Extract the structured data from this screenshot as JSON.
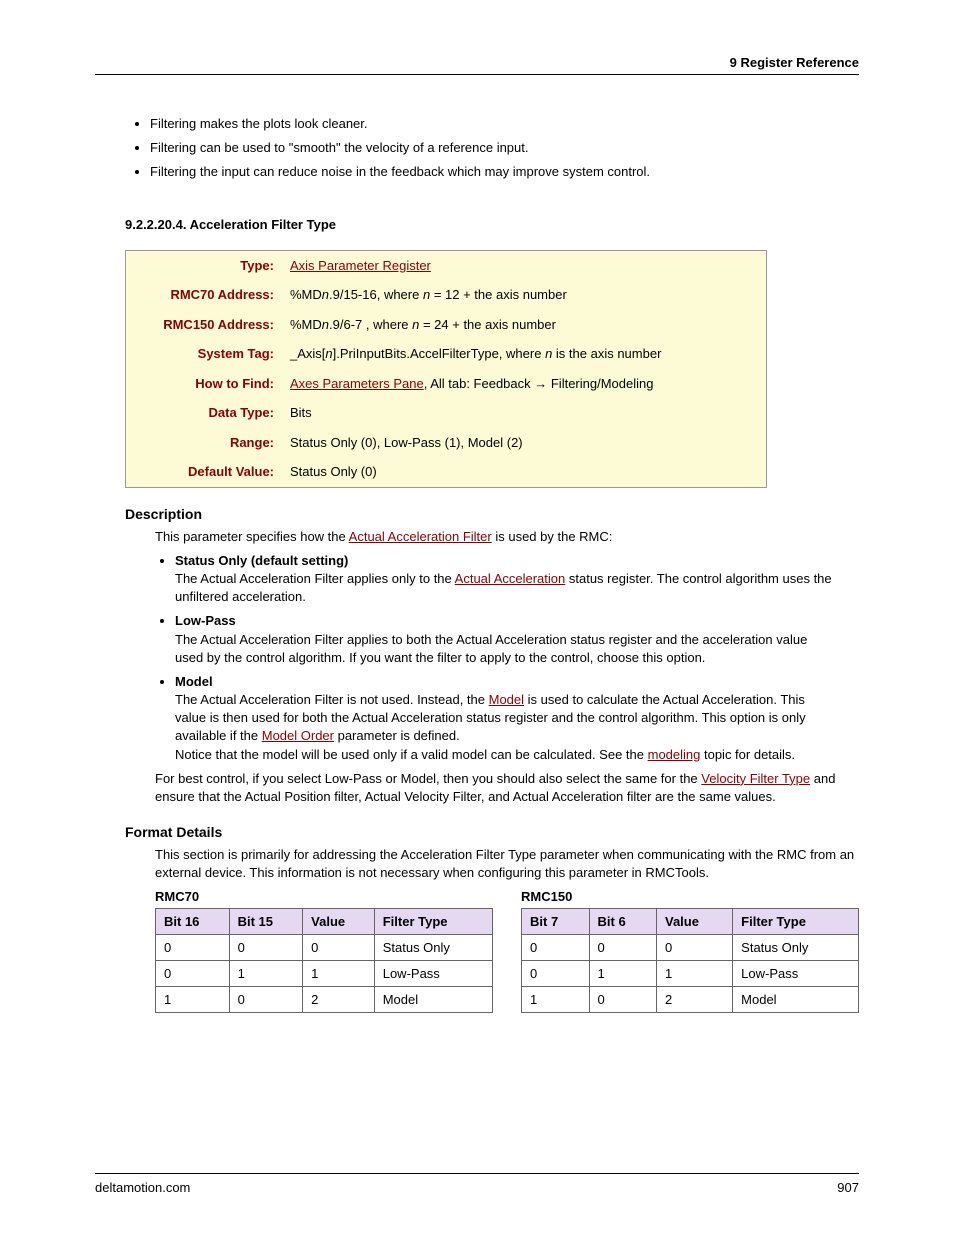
{
  "header": "9  Register Reference",
  "intro_bullets": [
    "Filtering makes the plots look cleaner.",
    "Filtering can be used to \"smooth\" the velocity of a reference input.",
    "Filtering the input can reduce noise in the feedback which may improve system control."
  ],
  "section_number": "9.2.2.20.4. Acceleration Filter Type",
  "params": {
    "type_label": "Type:",
    "type_value": "Axis Parameter Register",
    "rmc70_label": "RMC70 Address:",
    "rmc70_pre": "%MD",
    "rmc70_n": "n",
    "rmc70_mid": ".9/15-16, where ",
    "rmc70_n2": "n",
    "rmc70_post": " = 12 + the axis number",
    "rmc150_label": "RMC150 Address:",
    "rmc150_pre": "%MD",
    "rmc150_n": "n",
    "rmc150_mid": ".9/6-7 , where ",
    "rmc150_n2": "n",
    "rmc150_post": " = 24 + the axis number",
    "systag_label": "System Tag:",
    "systag_pre": "_Axis[",
    "systag_n": "n",
    "systag_mid": "].PriInputBits.AccelFilterType, where ",
    "systag_n2": "n",
    "systag_post": " is the axis number",
    "howto_label": "How to Find:",
    "howto_link": "Axes Parameters Pane",
    "howto_rest": ", All tab: Feedback → Filtering/Modeling",
    "datatype_label": "Data Type:",
    "datatype_value": "Bits",
    "range_label": "Range:",
    "range_value": "Status Only (0), Low-Pass (1), Model (2)",
    "default_label": "Default Value:",
    "default_value": "Status Only (0)"
  },
  "desc_heading": "Description",
  "desc_intro_pre": "This parameter specifies how the ",
  "desc_intro_link": "Actual Acceleration Filter",
  "desc_intro_post": " is used by the RMC:",
  "opt1_title": "Status Only (default setting)",
  "opt1_pre": "The Actual Acceleration Filter applies only to the ",
  "opt1_link": "Actual Acceleration",
  "opt1_post": " status register. The control algorithm uses the unfiltered acceleration.",
  "opt2_title": "Low-Pass",
  "opt2_body": "The Actual Acceleration Filter applies to both the Actual Acceleration status register and the acceleration value used by the control algorithm. If you want the filter to apply to the control, choose this option.",
  "opt3_title": "Model",
  "opt3_p1_pre": "The Actual Acceleration Filter is not used. Instead, the ",
  "opt3_p1_link1": "Model",
  "opt3_p1_mid": " is used to calculate the Actual Acceleration. This value is then used for both the Actual Acceleration status register and the control algorithm. This option is only available if the ",
  "opt3_p1_link2": "Model Order",
  "opt3_p1_post": " parameter is defined.",
  "opt3_p2_pre": "Notice that the model will be used only if a valid model can be calculated. See the ",
  "opt3_p2_link": "modeling",
  "opt3_p2_post": " topic for details.",
  "desc_tail_pre": "For best control, if you select Low-Pass or Model, then you should also select the same for the ",
  "desc_tail_link": "Velocity Filter Type",
  "desc_tail_post": " and ensure that the Actual Position filter, Actual Velocity Filter, and Actual Acceleration filter are the same values.",
  "format_heading": "Format Details",
  "format_intro": "This section is primarily for addressing the Acceleration Filter Type parameter when communicating with the RMC from an external device. This information is not necessary when configuring this parameter in RMCTools.",
  "rmc70_title": "RMC70",
  "rmc150_title": "RMC150",
  "table70": {
    "h1": "Bit 16",
    "h2": "Bit 15",
    "h3": "Value",
    "h4": "Filter Type",
    "rows": [
      [
        "0",
        "0",
        "0",
        "Status Only"
      ],
      [
        "0",
        "1",
        "1",
        "Low-Pass"
      ],
      [
        "1",
        "0",
        "2",
        "Model"
      ]
    ]
  },
  "table150": {
    "h1": "Bit 7",
    "h2": "Bit 6",
    "h3": "Value",
    "h4": "Filter Type",
    "rows": [
      [
        "0",
        "0",
        "0",
        "Status Only"
      ],
      [
        "0",
        "1",
        "1",
        "Low-Pass"
      ],
      [
        "1",
        "0",
        "2",
        "Model"
      ]
    ]
  },
  "footer_left": "deltamotion.com",
  "footer_right": "907"
}
